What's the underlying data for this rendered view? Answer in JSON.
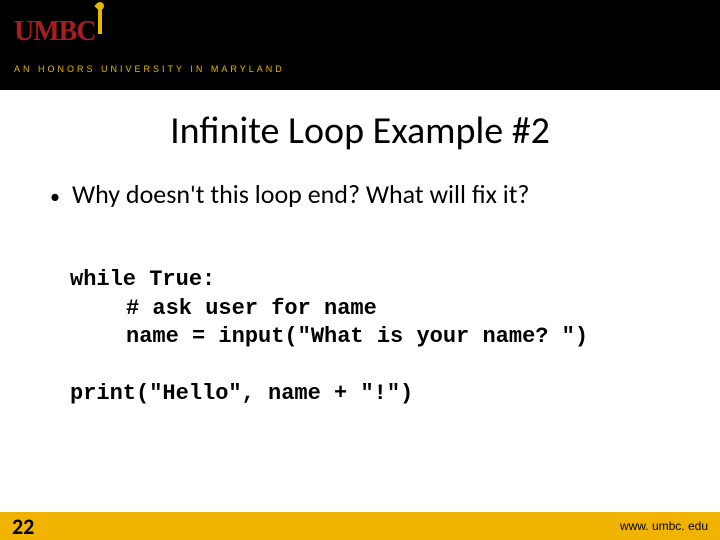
{
  "header": {
    "logo_letters": {
      "u": "U",
      "m": "M",
      "b": "B",
      "c": "C"
    },
    "tagline": "AN HONORS UNIVERSITY IN MARYLAND"
  },
  "slide": {
    "title": "Infinite Loop Example #2",
    "bullet_marker": "•",
    "bullet_text": "Why doesn't this loop end?  What will fix it?"
  },
  "code": {
    "line1": "while True:",
    "line2": "# ask user for name",
    "line3": "name = input(\"What is your name? \")",
    "line4": "print(\"Hello\", name + \"!\")"
  },
  "footer": {
    "slide_number": "22",
    "url": "www. umbc. edu"
  }
}
